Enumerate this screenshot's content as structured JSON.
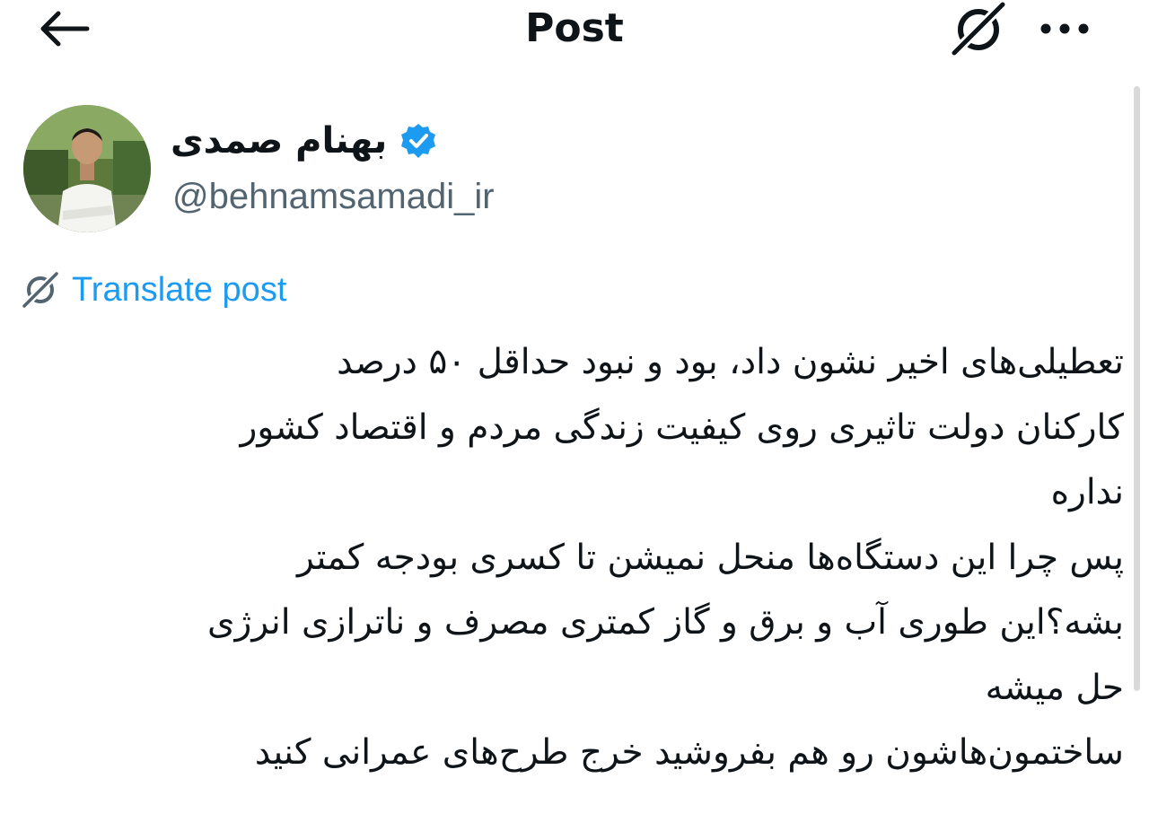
{
  "header": {
    "title": "Post"
  },
  "author": {
    "display_name": "بهنام صمدی",
    "handle": "@behnamsamadi_ir",
    "verified_color": "#1d9bf0"
  },
  "translate": {
    "label": "Translate post"
  },
  "tweet": {
    "lines": [
      "تعطیلی‌های اخیر نشون داد، بود و نبود حداقل ۵۰ درصد",
      "کارکنان دولت تاثیری روی کیفیت زندگی مردم و اقتصاد کشور",
      "نداره",
      "پس چرا این دستگاه‌ها منحل نمیشن تا کسری بودجه کمتر",
      "بشه؟این طوری آب و برق و گاز کمتری مصرف و ناترازی انرژی",
      "حل میشه",
      "ساختمون‌هاشون رو هم بفروشید خرج طرح‌های عمرانی کنید"
    ]
  },
  "icons": {
    "back": "arrow-left-icon",
    "grok": "grok-icon",
    "more": "more-horizontal-icon",
    "verified": "verified-badge-icon",
    "translate": "grok-translate-icon"
  }
}
